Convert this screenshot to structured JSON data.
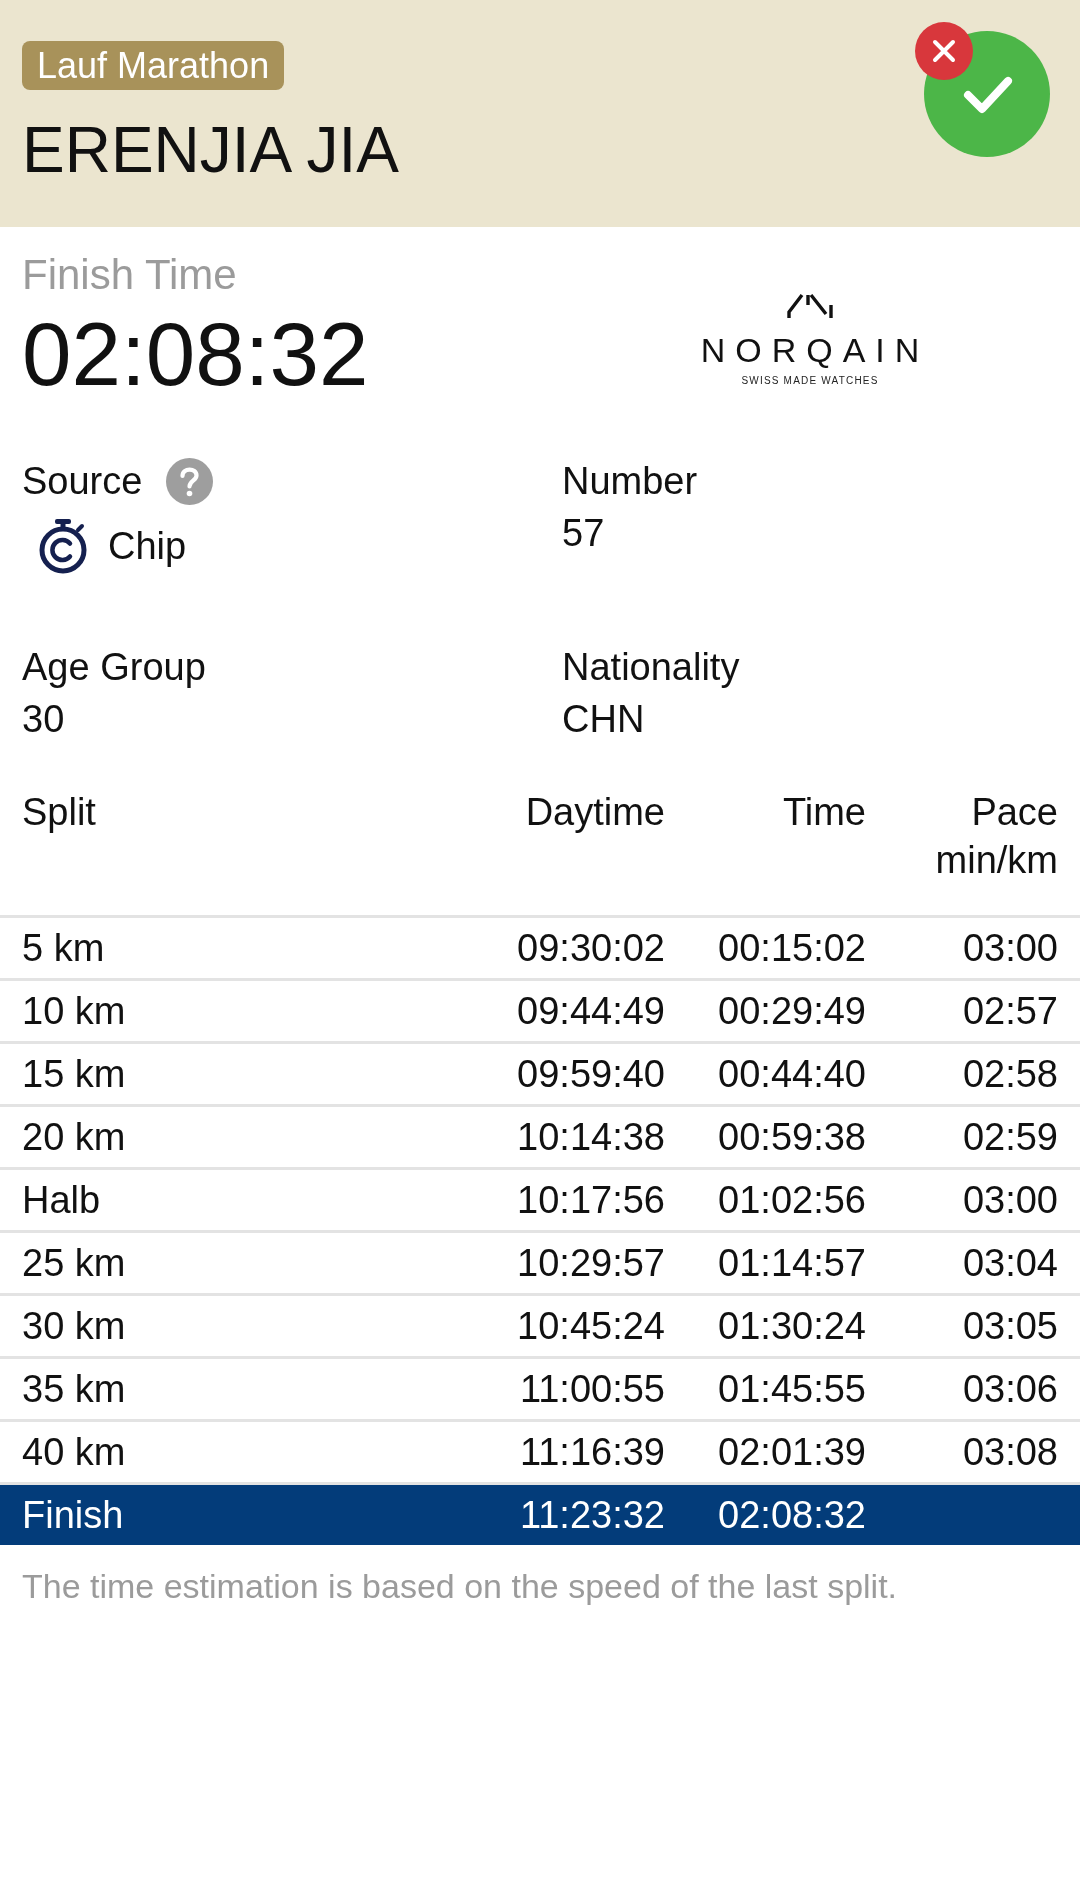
{
  "header": {
    "event": "Lauf Marathon",
    "athlete_name": "ERENJIA JIA"
  },
  "result": {
    "label": "Finish Time",
    "value": "02:08:32"
  },
  "sponsor": {
    "name": "NORQAIN",
    "tagline": "SWISS MADE WATCHES"
  },
  "details": [
    {
      "kind": "source",
      "label": "Source",
      "value": "Chip"
    },
    {
      "kind": "text",
      "label": "Number",
      "value": "57"
    },
    {
      "kind": "text",
      "label": "Age Group",
      "value": "30"
    },
    {
      "kind": "text",
      "label": "Nationality",
      "value": "CHN"
    }
  ],
  "splits": {
    "columns": [
      {
        "label": "Split"
      },
      {
        "label": "Daytime"
      },
      {
        "label": "Time"
      },
      {
        "label": "Pace",
        "unit": "min/km"
      }
    ],
    "rows": [
      {
        "split": "5 km",
        "daytime": "09:30:02",
        "time": "00:15:02",
        "pace": "03:00",
        "highlighted": false
      },
      {
        "split": "10 km",
        "daytime": "09:44:49",
        "time": "00:29:49",
        "pace": "02:57",
        "highlighted": false
      },
      {
        "split": "15 km",
        "daytime": "09:59:40",
        "time": "00:44:40",
        "pace": "02:58",
        "highlighted": false
      },
      {
        "split": "20 km",
        "daytime": "10:14:38",
        "time": "00:59:38",
        "pace": "02:59",
        "highlighted": false
      },
      {
        "split": "Halb",
        "daytime": "10:17:56",
        "time": "01:02:56",
        "pace": "03:00",
        "highlighted": false
      },
      {
        "split": "25 km",
        "daytime": "10:29:57",
        "time": "01:14:57",
        "pace": "03:04",
        "highlighted": false
      },
      {
        "split": "30 km",
        "daytime": "10:45:24",
        "time": "01:30:24",
        "pace": "03:05",
        "highlighted": false
      },
      {
        "split": "35 km",
        "daytime": "11:00:55",
        "time": "01:45:55",
        "pace": "03:06",
        "highlighted": false
      },
      {
        "split": "40 km",
        "daytime": "11:16:39",
        "time": "02:01:39",
        "pace": "03:08",
        "highlighted": false
      },
      {
        "split": "Finish",
        "daytime": "11:23:32",
        "time": "02:08:32",
        "highlighted": true
      }
    ]
  },
  "note": "The time estimation is based on the speed of the last split."
}
